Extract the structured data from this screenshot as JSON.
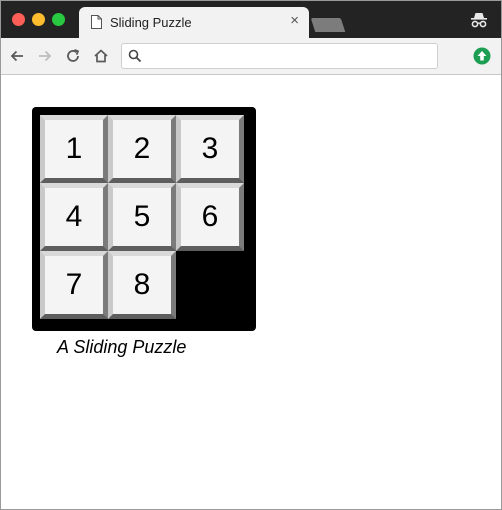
{
  "browser": {
    "tab_title": "Sliding Puzzle",
    "tab_close": "×",
    "address_value": "",
    "icons": {
      "back": "arrow-left-icon",
      "forward": "arrow-right-icon",
      "reload": "reload-icon",
      "home": "home-icon",
      "search": "search-icon",
      "update": "update-arrow-icon",
      "incognito": "incognito-icon",
      "page": "document-icon"
    },
    "colors": {
      "update": "#1e9e52",
      "forward_disabled": "#bdbdbd"
    }
  },
  "puzzle": {
    "tiles": [
      "1",
      "2",
      "3",
      "4",
      "5",
      "6",
      "7",
      "8"
    ],
    "caption": "A Sliding Puzzle"
  }
}
